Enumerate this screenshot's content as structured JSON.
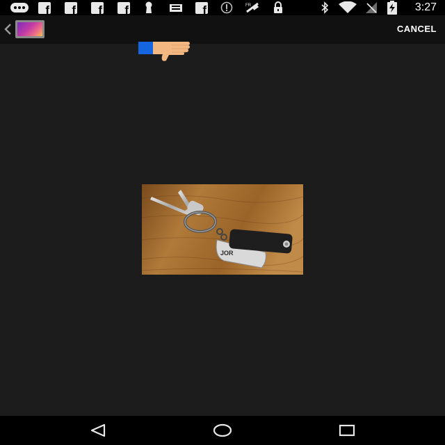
{
  "status_bar": {
    "time": "3:27",
    "icons": [
      "messenger-icon",
      "facebook-icon",
      "facebook-icon",
      "facebook-icon",
      "facebook-icon",
      "keyhole-icon",
      "tray-icon",
      "facebook-icon",
      "info-icon",
      "satellite-icon",
      "lock-icon",
      "bluetooth-icon",
      "wifi-icon",
      "no-signal-icon",
      "battery-charging-icon"
    ]
  },
  "action_bar": {
    "app_icon": "gallery-icon",
    "cancel_label": "CANCEL"
  },
  "content": {
    "pointer_icon": "thumbs-down-icon",
    "photo": {
      "subject": "keys-with-tag-photo",
      "tag_text": "JOR"
    }
  },
  "nav_bar": {
    "back": "back-icon",
    "home": "home-icon",
    "recents": "recents-icon"
  },
  "colors": {
    "background": "#1c1c1c",
    "action_bar": "#111111",
    "status_bar": "#000000",
    "accent_blue": "#1565e0",
    "skin": "#f3b781"
  }
}
